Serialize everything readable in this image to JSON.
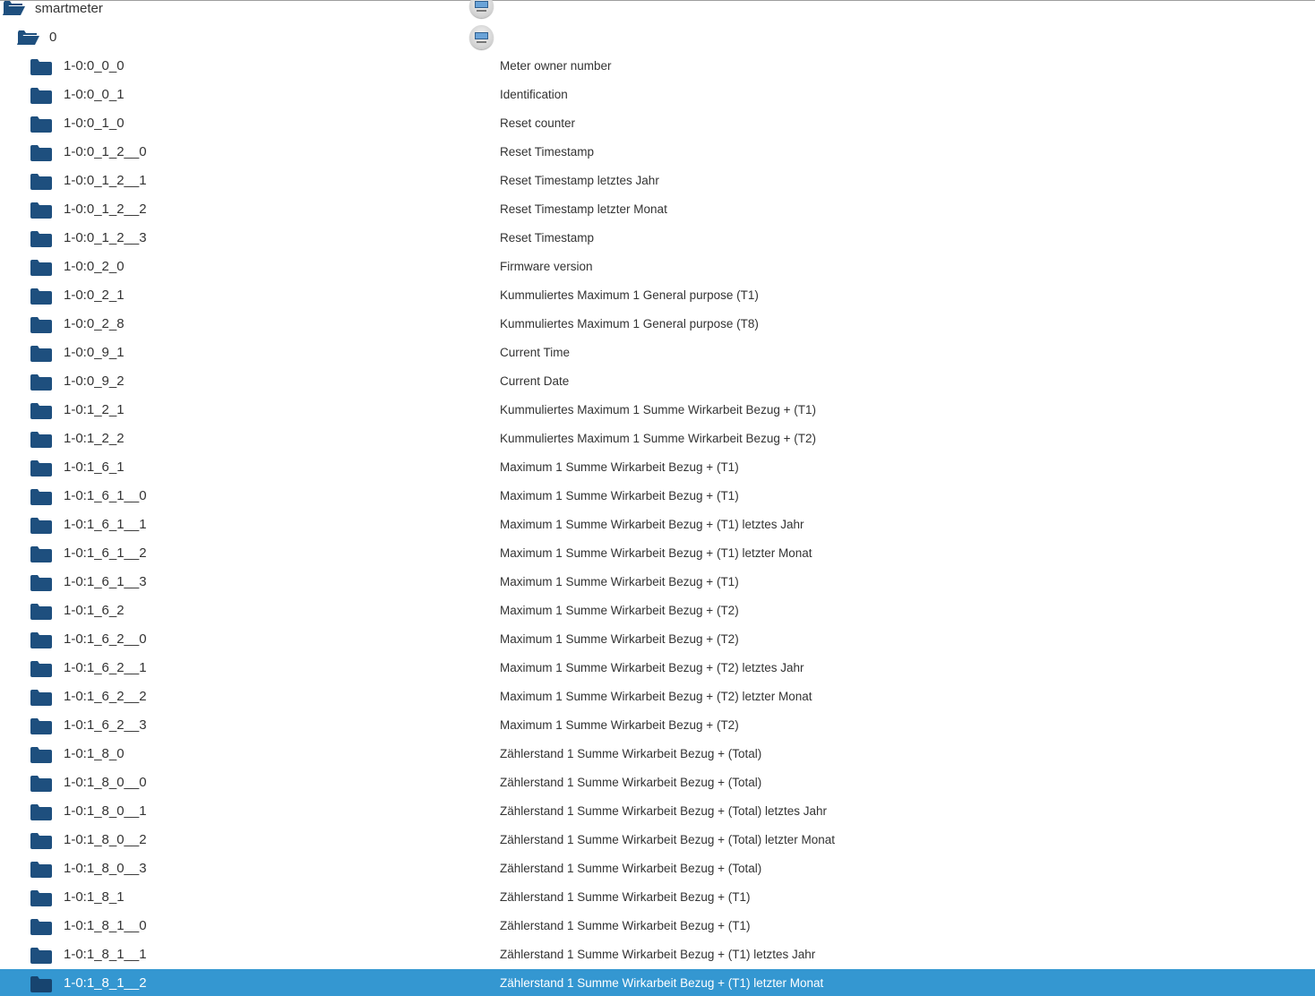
{
  "tree": {
    "root": {
      "label": "smartmeter",
      "icon": "folder-open-icon",
      "type_icon": "channel-icon"
    },
    "channel": {
      "label": "0",
      "icon": "folder-open-icon",
      "type_icon": "channel-icon"
    },
    "items": [
      {
        "name": "1-0:0_0_0",
        "description": "Meter owner number"
      },
      {
        "name": "1-0:0_0_1",
        "description": "Identification"
      },
      {
        "name": "1-0:0_1_0",
        "description": "Reset counter"
      },
      {
        "name": "1-0:0_1_2__0",
        "description": "Reset Timestamp"
      },
      {
        "name": "1-0:0_1_2__1",
        "description": "Reset Timestamp letztes Jahr"
      },
      {
        "name": "1-0:0_1_2__2",
        "description": "Reset Timestamp letzter Monat"
      },
      {
        "name": "1-0:0_1_2__3",
        "description": "Reset Timestamp"
      },
      {
        "name": "1-0:0_2_0",
        "description": "Firmware version"
      },
      {
        "name": "1-0:0_2_1",
        "description": "Kummuliertes Maximum 1 General purpose (T1)"
      },
      {
        "name": "1-0:0_2_8",
        "description": "Kummuliertes Maximum 1 General purpose (T8)"
      },
      {
        "name": "1-0:0_9_1",
        "description": "Current Time"
      },
      {
        "name": "1-0:0_9_2",
        "description": "Current Date"
      },
      {
        "name": "1-0:1_2_1",
        "description": "Kummuliertes Maximum 1 Summe Wirkarbeit Bezug + (T1)"
      },
      {
        "name": "1-0:1_2_2",
        "description": "Kummuliertes Maximum 1 Summe Wirkarbeit Bezug + (T2)"
      },
      {
        "name": "1-0:1_6_1",
        "description": "Maximum 1 Summe Wirkarbeit Bezug + (T1)"
      },
      {
        "name": "1-0:1_6_1__0",
        "description": "Maximum 1 Summe Wirkarbeit Bezug + (T1)"
      },
      {
        "name": "1-0:1_6_1__1",
        "description": "Maximum 1 Summe Wirkarbeit Bezug + (T1) letztes Jahr"
      },
      {
        "name": "1-0:1_6_1__2",
        "description": "Maximum 1 Summe Wirkarbeit Bezug + (T1) letzter Monat"
      },
      {
        "name": "1-0:1_6_1__3",
        "description": "Maximum 1 Summe Wirkarbeit Bezug + (T1)"
      },
      {
        "name": "1-0:1_6_2",
        "description": "Maximum 1 Summe Wirkarbeit Bezug + (T2)"
      },
      {
        "name": "1-0:1_6_2__0",
        "description": "Maximum 1 Summe Wirkarbeit Bezug + (T2)"
      },
      {
        "name": "1-0:1_6_2__1",
        "description": "Maximum 1 Summe Wirkarbeit Bezug + (T2) letztes Jahr"
      },
      {
        "name": "1-0:1_6_2__2",
        "description": "Maximum 1 Summe Wirkarbeit Bezug + (T2) letzter Monat"
      },
      {
        "name": "1-0:1_6_2__3",
        "description": "Maximum 1 Summe Wirkarbeit Bezug + (T2)"
      },
      {
        "name": "1-0:1_8_0",
        "description": "Zählerstand 1 Summe Wirkarbeit Bezug + (Total)"
      },
      {
        "name": "1-0:1_8_0__0",
        "description": "Zählerstand 1 Summe Wirkarbeit Bezug + (Total)"
      },
      {
        "name": "1-0:1_8_0__1",
        "description": "Zählerstand 1 Summe Wirkarbeit Bezug + (Total) letztes Jahr"
      },
      {
        "name": "1-0:1_8_0__2",
        "description": "Zählerstand 1 Summe Wirkarbeit Bezug + (Total) letzter Monat"
      },
      {
        "name": "1-0:1_8_0__3",
        "description": "Zählerstand 1 Summe Wirkarbeit Bezug + (Total)"
      },
      {
        "name": "1-0:1_8_1",
        "description": "Zählerstand 1 Summe Wirkarbeit Bezug + (T1)"
      },
      {
        "name": "1-0:1_8_1__0",
        "description": "Zählerstand 1 Summe Wirkarbeit Bezug + (T1)"
      },
      {
        "name": "1-0:1_8_1__1",
        "description": "Zählerstand 1 Summe Wirkarbeit Bezug + (T1) letztes Jahr"
      },
      {
        "name": "1-0:1_8_1__2",
        "description": "Zählerstand 1 Summe Wirkarbeit Bezug + (T1) letzter Monat",
        "selected": true
      }
    ]
  },
  "colors": {
    "folder": "#1e4f7e",
    "selected_background": "#3497d1",
    "selected_text": "#ffffff",
    "text": "#333333"
  }
}
